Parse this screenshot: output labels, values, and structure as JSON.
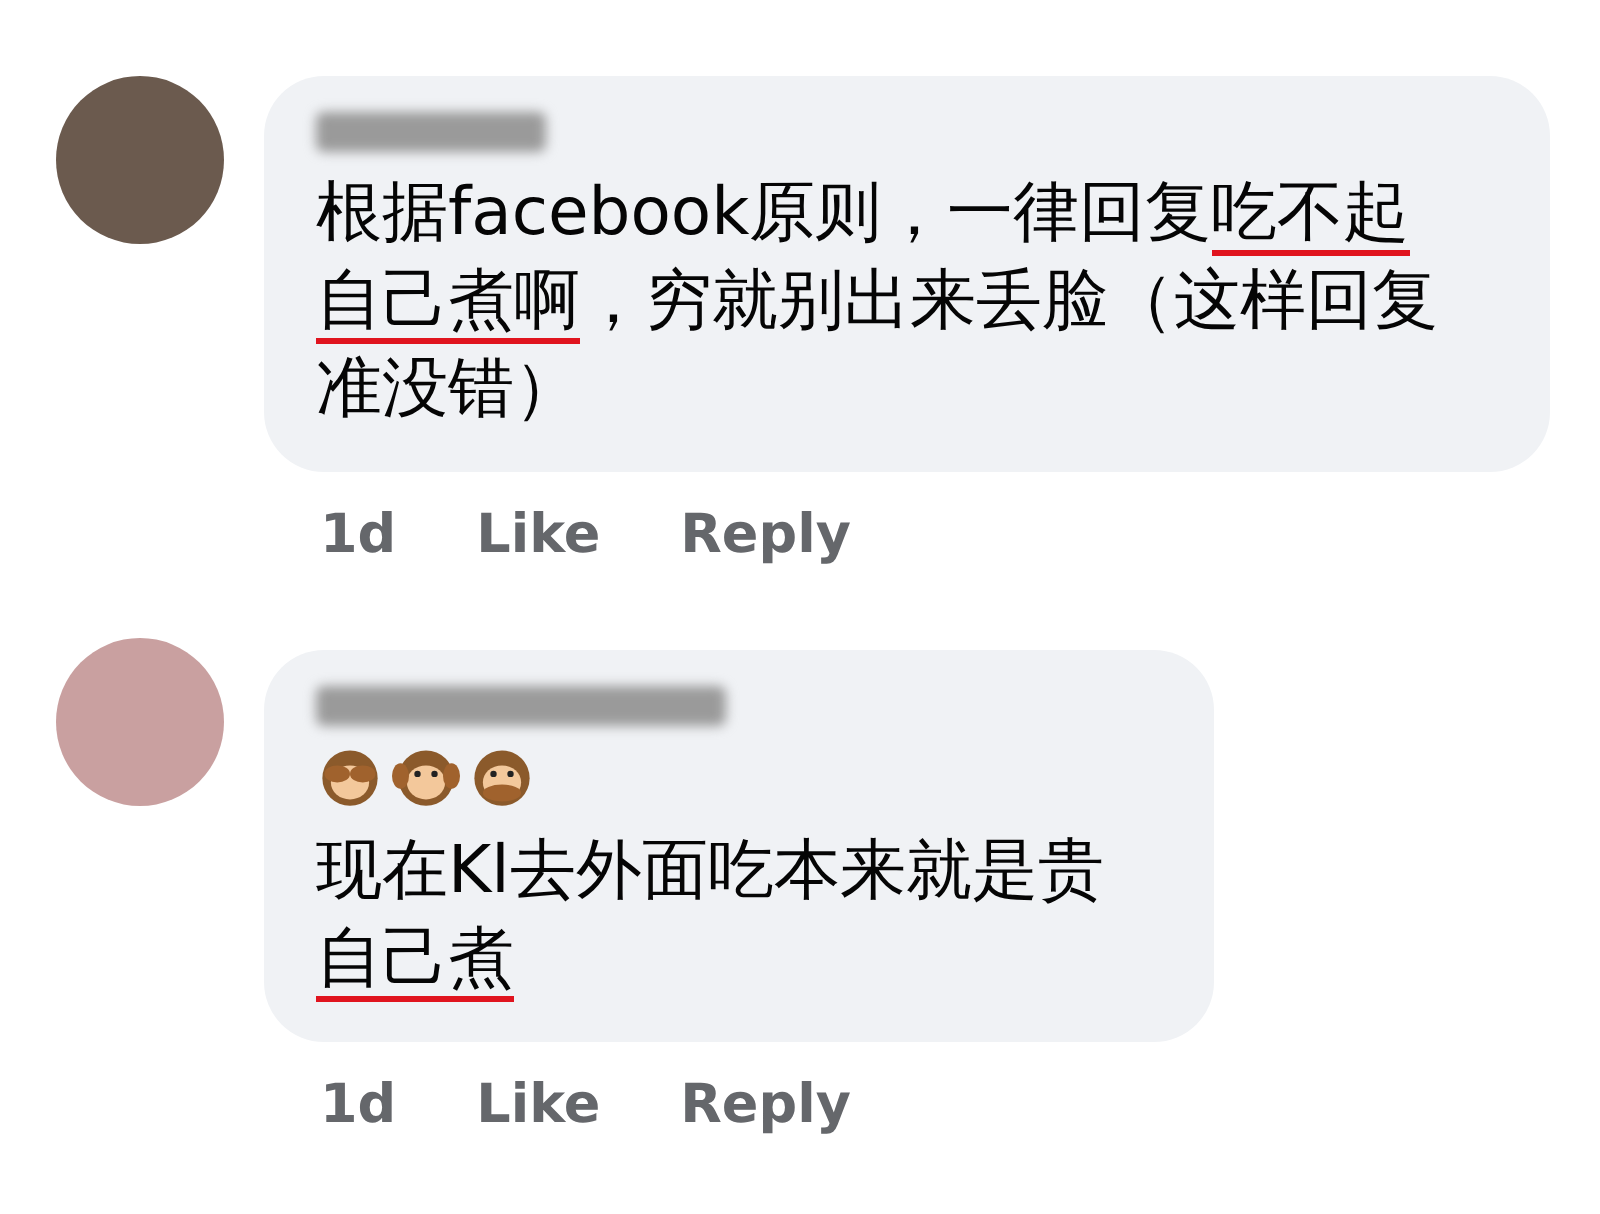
{
  "comments": [
    {
      "text": [
        {
          "t": "根据facebook原则，一律回复",
          "underlined": false
        },
        {
          "t": "吃不起自己煮啊",
          "underlined": true
        },
        {
          "t": "，穷就别出来丢脸（这样回复准没错）",
          "underlined": false
        }
      ],
      "time": "1d",
      "actions": [
        "Like",
        "Reply"
      ]
    },
    {
      "emoji": [
        {
          "kind": "see-no-evil"
        },
        {
          "kind": "hear-no-evil"
        },
        {
          "kind": "speak-no-evil"
        }
      ],
      "text": [
        {
          "t": "现在Kl去外面吃本来就是贵",
          "underlined": false
        },
        {
          "t": "自己煮",
          "underlined": true
        }
      ],
      "time": "1d",
      "actions": [
        "Like",
        "Reply"
      ]
    }
  ]
}
